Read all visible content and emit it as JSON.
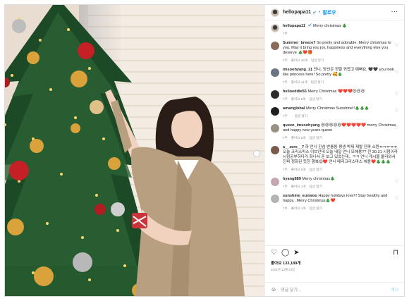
{
  "header": {
    "username": "hellopapa11",
    "verified_icon": "verified-badge-icon",
    "follow_label": "팔로우",
    "more_icon": "more-dots-icon"
  },
  "caption": {
    "username": "hellopapa11",
    "text": "Merry christmas 🎄",
    "time": "7주"
  },
  "comments": [
    {
      "username": "Summer_breeze7",
      "text": "So pretty and adorable. Merry christmas to you. May it bring you joy, happiness and everything else you deserve 🎄❤️🎁",
      "time": "7주",
      "likes": "좋아요 15개",
      "reply": "답글 달기",
      "avatar_color": "#8a6a5a"
    },
    {
      "username": "imsoohyang_11",
      "text": "언니, 당신은 정말 귀엽고 예뻐요. 🖤🖤 you look like princess here! So pretty 🥰🎄",
      "time": "7주",
      "likes": "좋아요 11개",
      "reply": "답글 달기",
      "avatar_color": "#6a7480"
    },
    {
      "username": "helloeddie55",
      "text": "Merry Christmas ❤️❤️❤️😍😍😍",
      "time": "7주",
      "likes": "좋아요 5개",
      "reply": "답글 달기",
      "avatar_color": "#2c2c30"
    },
    {
      "username": "amariglobal",
      "text": "Merry Christmas Sunshine!!🎄🎄🎄",
      "time": "7주",
      "likes": "",
      "reply": "답글 달기",
      "avatar_color": "#1f1f1f"
    },
    {
      "username": "queen_imsoohyang",
      "text": "😍😍😍😍😍❤️❤️❤️❤️❤️ merry Christmas and happy new years queen",
      "time": "7주",
      "likes": "좋아요 5개",
      "reply": "답글 달기",
      "avatar_color": "#9a8f85"
    },
    {
      "username": "a__zero__7",
      "text": "하 언니 진심 반룡용 평생 박제 제발 진짜 소원ㅠㅠㅠㅠㅠ 오늘 크리스마스 이브인데 오늘 내일 언니 모해용?? 전 30.31 시험이라 시험공부하다가 화나서 폰 보고 있었는데.. ㅋㅋ 언니 게시물 올라와서 진짜 정화된 듯한 행복😍❤️ 언니 메리크리스마스 해용❤️🎄🎄🎄",
      "time": "7주",
      "likes": "좋아요 5개",
      "reply": "답글 달기",
      "avatar_color": "#7a5a48"
    },
    {
      "username": "hyang889",
      "text": "Merry christmas🎄",
      "time": "7주",
      "likes": "좋아요 1개",
      "reply": "답글 달기",
      "avatar_color": "#c7a8b0"
    },
    {
      "username": "sunshine_eunwoo",
      "text": "Happy holidays love!!! Stay healthy and happy.. Merry Christmas🎄❤️",
      "time": "7주",
      "likes": "좋아요 1개",
      "reply": "답글 달기",
      "avatar_color": "#b4b4b4"
    }
  ],
  "actions": {
    "like_icon": "heart-outline-icon",
    "comment_icon": "comment-icon",
    "share_icon": "paper-plane-icon",
    "save_icon": "bookmark-icon",
    "likes_count": "좋아요 133,189개",
    "date": "2021년 12월 24일"
  },
  "add_comment": {
    "emoji_icon": "smiley-icon",
    "placeholder": "댓글 달기...",
    "post_label": "게시"
  }
}
